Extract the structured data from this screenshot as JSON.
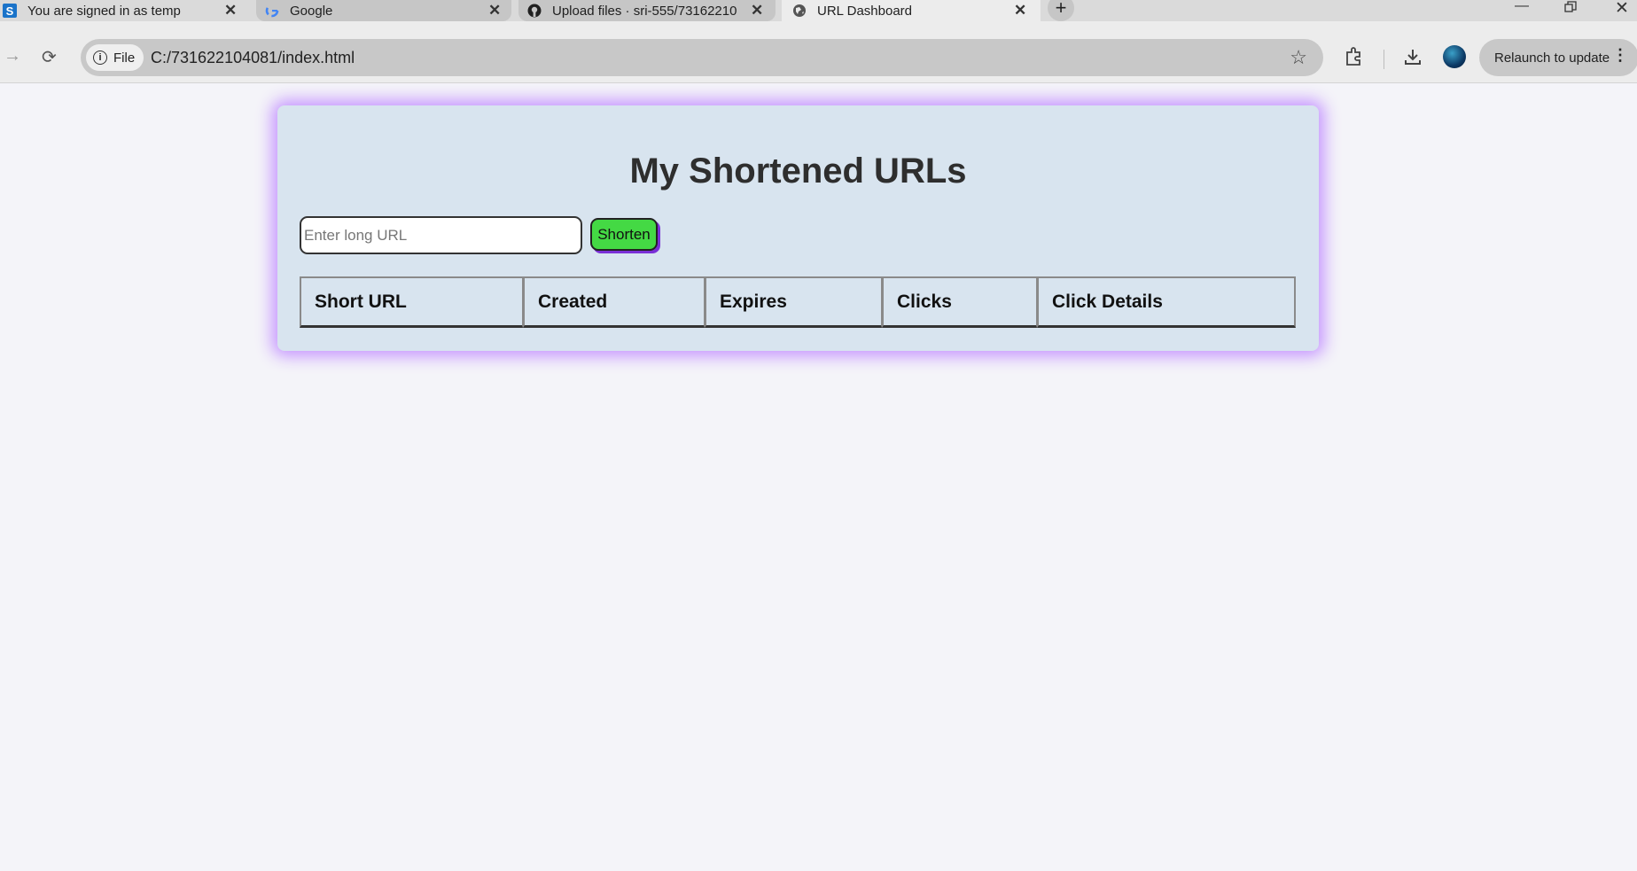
{
  "browser": {
    "tabs": [
      {
        "label": "You are signed in as temp",
        "favicon": "s-logo-icon"
      },
      {
        "label": "Google",
        "favicon": "google-icon"
      },
      {
        "label": "Upload files · sri-555/73162210",
        "favicon": "github-icon"
      },
      {
        "label": "URL Dashboard",
        "favicon": "globe-icon",
        "active": true
      }
    ],
    "address_chip": "File",
    "url": "C:/731622104081/index.html",
    "relaunch_label": "Relaunch to update"
  },
  "page": {
    "title": "My Shortened URLs",
    "input_placeholder": "Enter long URL",
    "input_value": "",
    "shorten_label": "Shorten",
    "table_headers": [
      "Short URL",
      "Created",
      "Expires",
      "Clicks",
      "Click Details"
    ],
    "table_rows": []
  },
  "colors": {
    "page_background": "#f4f4f9",
    "card_background": "#d8e4ef",
    "card_glow": "#c594ff",
    "button_background": "#44d944",
    "button_shadow": "#7a2fd6"
  }
}
